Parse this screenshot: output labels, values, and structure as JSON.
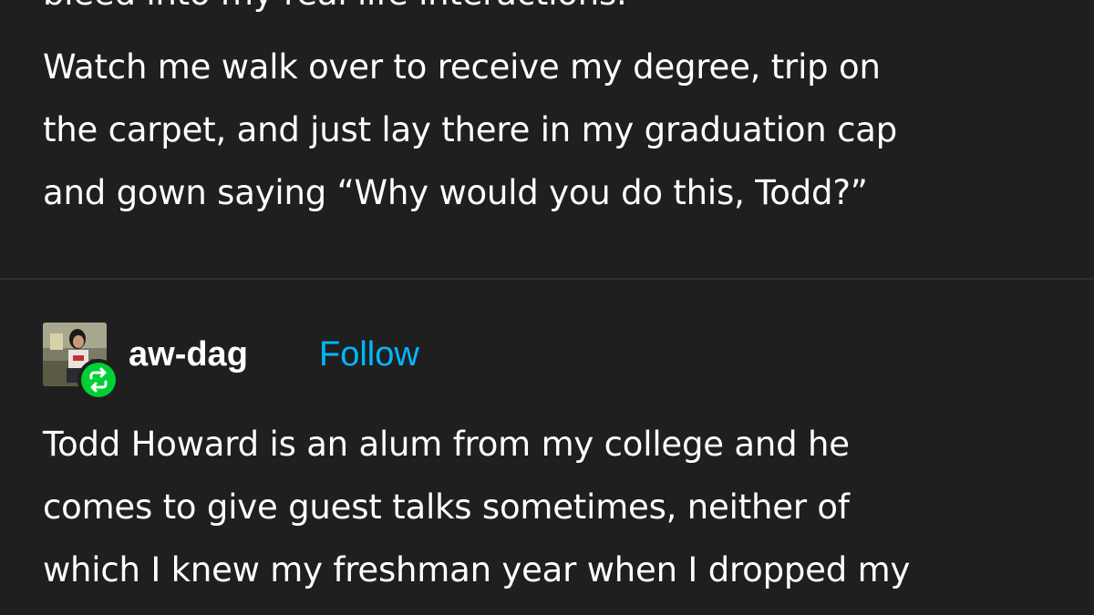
{
  "first_post": {
    "lines": [
      "bleed into my real life interactions.",
      "Watch me walk over to receive my degree, trip on",
      "the carpet, and just lay there in my graduation cap",
      "and gown saying “Why would you do this, Todd?”"
    ]
  },
  "second_post": {
    "username": "aw-dag",
    "follow_label": "Follow",
    "avatar_icon": "user-avatar",
    "reblog_icon": "reblog-icon",
    "accent_color": "#00b8ff",
    "reblog_color": "#00cf35",
    "lines": [
      "Todd Howard is an alum from my college and he",
      "comes to give guest talks sometimes, neither of",
      "which I knew my freshman year when I dropped my"
    ]
  }
}
